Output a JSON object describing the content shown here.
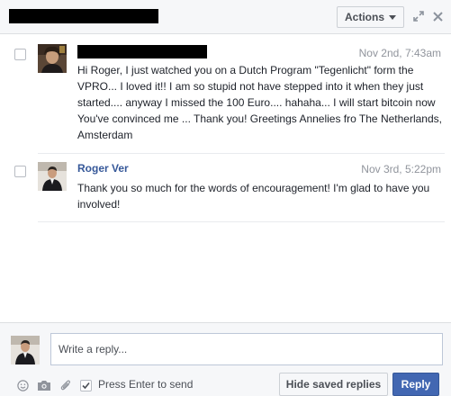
{
  "header": {
    "actions_label": "Actions",
    "icons": [
      "expand-icon",
      "close-icon"
    ]
  },
  "messages": [
    {
      "sender": "",
      "time": "Nov 2nd, 7:43am",
      "text": "Hi Roger, I just watched you on a Dutch Program \"Tegenlicht\" form the VPRO... I loved it!! I am so stupid not have stepped into it when they just started.... anyway I missed the 100 Euro.... hahaha... I will start bitcoin now You've convinced me ... Thank you! Greetings Annelies fro The Netherlands, Amsterdam"
    },
    {
      "sender": "Roger Ver",
      "time": "Nov 3rd, 5:22pm",
      "text": "Thank you so much for the words of encouragement!  I'm glad to have you involved!"
    }
  ],
  "composer": {
    "placeholder": "Write a reply...",
    "press_enter_label": "Press Enter to send",
    "press_enter_checked": true,
    "hide_saved_label": "Hide saved replies",
    "reply_label": "Reply",
    "tool_icons": [
      "emoji-icon",
      "camera-icon",
      "attachment-icon"
    ]
  },
  "colors": {
    "link": "#365899",
    "primary_button": "#4267b2",
    "timestamp": "#90949c"
  }
}
